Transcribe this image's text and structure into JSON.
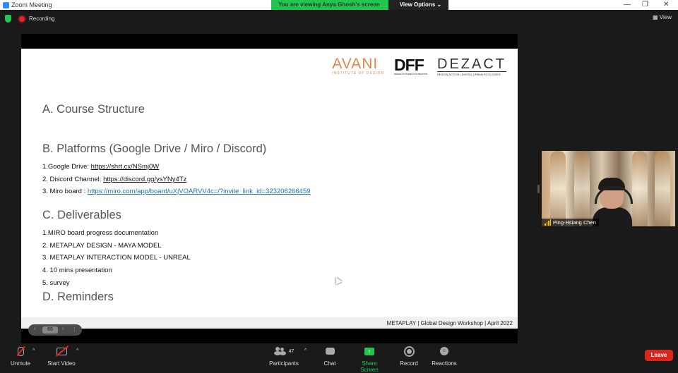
{
  "window": {
    "title": "Zoom Meeting",
    "minimize": "—",
    "restore": "❐",
    "close": "✕"
  },
  "banner": {
    "viewing": "You are viewing Anya Ghosh's screen",
    "view_options": "View Options ⌄"
  },
  "status": {
    "recording": "Recording",
    "view": "View"
  },
  "slide": {
    "logos": {
      "avani": "AVANI",
      "avani_sub": "INSTITUTE OF DESIGN",
      "dff": "DFF",
      "dff_sub": "DESIGN FUTURES FOUNDATION",
      "dezact": "DEZACT",
      "dezact_sub": "DESIGN ACTION | DIGITAL URBAN ECOLOGIES"
    },
    "section_a": "A. Course Structure",
    "section_b": "B. Platforms (Google Drive / Miro / Discord)",
    "platforms": [
      {
        "label": "1.Google Drive: ",
        "url": "https://shrt.cx/NSmj0W"
      },
      {
        "label": "2. Discord Channel: ",
        "url": "https://discord.gg/ysYNy4Tz"
      },
      {
        "label": "3. Miro board : ",
        "url": "https://miro.com/app/board/uXjVOARVV4c=/?invite_link_id=323206266459"
      }
    ],
    "section_c": "C. Deliverables",
    "deliverables": [
      "1.MIRO board progress documentation",
      "2. METAPLAY DESIGN - MAYA MODEL",
      "3. METAPLAY INTERACTION MODEL - UNREAL",
      "4. 10 mins presentation",
      "5. survey"
    ],
    "section_d": "D. Reminders",
    "footer": "METAPLAY  |  Global Design Workshop  |  April 2022"
  },
  "pager": {
    "page": "65",
    "prev": "‹",
    "next": "›",
    "more": "⋮"
  },
  "participant": {
    "name": "Ping-Hsiang Chen"
  },
  "toolbar": {
    "unmute": "Unmute",
    "start_video": "Start Video",
    "participants": "Participants",
    "participants_count": "47",
    "chat": "Chat",
    "share_screen": "Share Screen",
    "record": "Record",
    "reactions": "Reactions",
    "leave": "Leave",
    "caret": "^"
  },
  "colors": {
    "share_green": "#23c552",
    "leave_red": "#d6261f",
    "avani_orange": "#e2864a",
    "link_blue": "#1a73c9"
  }
}
